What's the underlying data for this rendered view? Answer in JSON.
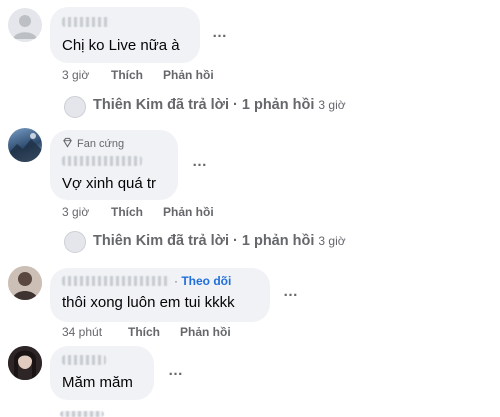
{
  "comments": [
    {
      "text": "Chị ko Live nữa à",
      "time": "3 giờ",
      "like": "Thích",
      "reply": "Phản hồi"
    },
    {
      "badge": "Fan cứng",
      "text": "Vợ xinh quá tr",
      "time": "3 giờ",
      "like": "Thích",
      "reply": "Phản hồi"
    },
    {
      "follow": "Theo dõi",
      "text": "thôi xong luôn em tui kkkk",
      "time": "34 phút",
      "like": "Thích",
      "reply": "Phản hồi"
    },
    {
      "text": "Măm măm"
    }
  ],
  "reply_summaries": [
    {
      "text": "Thiên Kim đã trả lời · 1 phản hồi",
      "time": "3 giờ"
    },
    {
      "text": "Thiên Kim đã trả lời · 1 phản hồi",
      "time": "3 giờ"
    }
  ],
  "more_icon": "…",
  "badge_icon": "diamond-icon"
}
